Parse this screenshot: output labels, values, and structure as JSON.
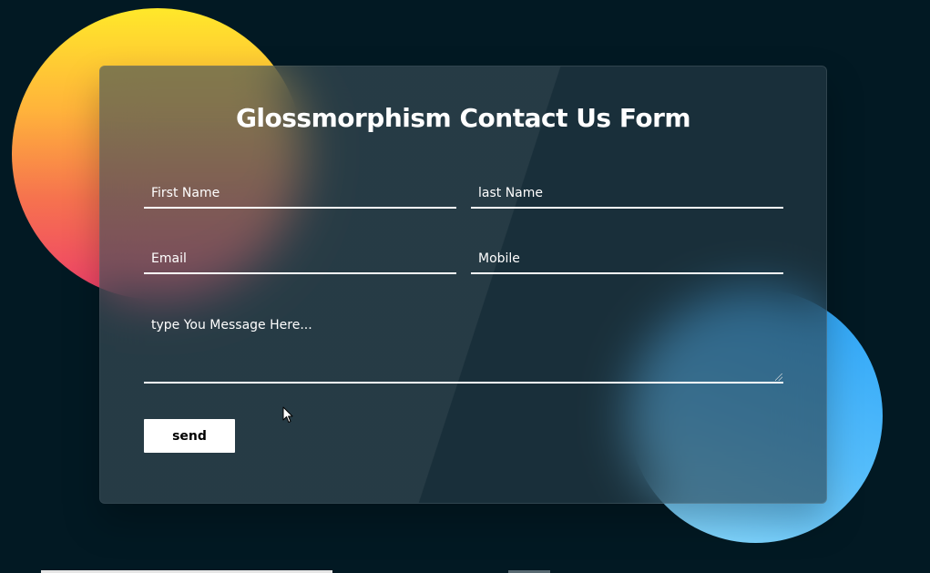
{
  "form": {
    "title": "Glossmorphism Contact Us Form",
    "fields": {
      "first_name": {
        "placeholder": "First Name",
        "value": ""
      },
      "last_name": {
        "placeholder": "last Name",
        "value": ""
      },
      "email": {
        "placeholder": "Email",
        "value": ""
      },
      "mobile": {
        "placeholder": "Mobile",
        "value": ""
      },
      "message": {
        "placeholder": "type You Message Here...",
        "value": ""
      }
    },
    "submit_label": "send"
  },
  "theme": {
    "background": "#021923",
    "warm_circle_top": "#ffe82a",
    "warm_circle_bottom": "#ef3d6b",
    "cool_circle_top": "#2aa3f7",
    "cool_circle_bottom": "#8cdcff",
    "button_bg": "#ffffff",
    "text": "#ffffff"
  },
  "icons": {
    "cursor": "mouse-pointer-icon",
    "textarea_grip": "resize-grip-icon"
  }
}
